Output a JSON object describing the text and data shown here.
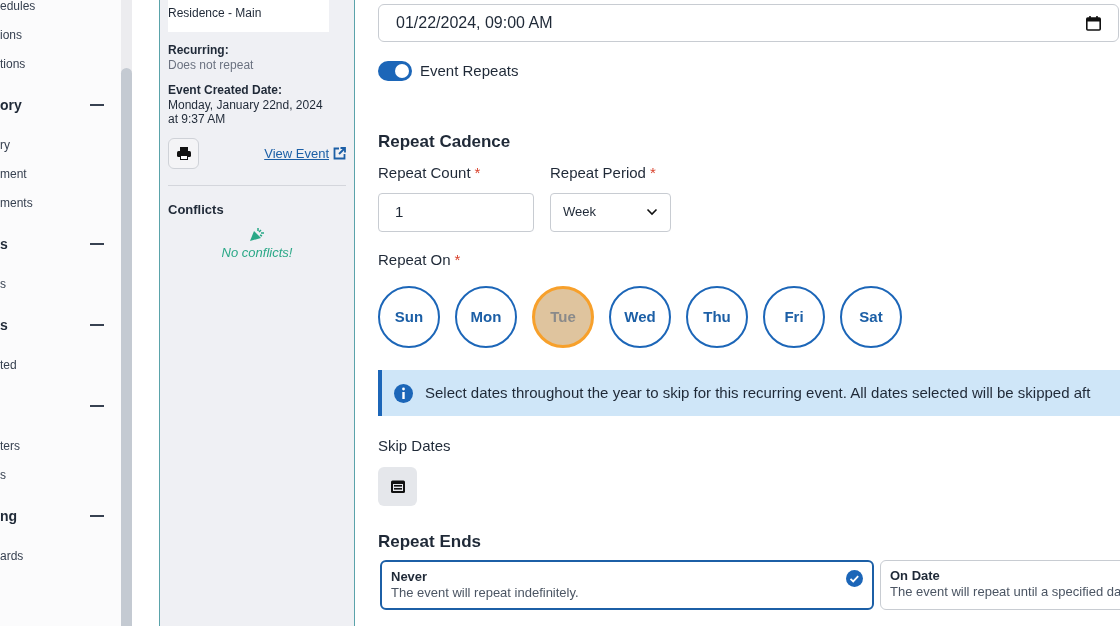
{
  "sidebar": {
    "items": [
      {
        "kind": "link",
        "label": "edules"
      },
      {
        "kind": "link",
        "label": "ions"
      },
      {
        "kind": "link",
        "label": "tions"
      },
      {
        "kind": "header",
        "label": "ory",
        "expanded": true
      },
      {
        "kind": "link",
        "label": "ry"
      },
      {
        "kind": "link",
        "label": "ment"
      },
      {
        "kind": "link",
        "label": "ments"
      },
      {
        "kind": "header",
        "label": "s",
        "expanded": true
      },
      {
        "kind": "link",
        "label": "s"
      },
      {
        "kind": "header",
        "label": "s",
        "expanded": true
      },
      {
        "kind": "link",
        "label": "ted"
      },
      {
        "kind": "header",
        "expanded": true
      },
      {
        "kind": "link",
        "label": "ters"
      },
      {
        "kind": "link",
        "label": "s"
      },
      {
        "kind": "header",
        "label": "ng",
        "expanded": true
      },
      {
        "kind": "link",
        "label": "ards"
      }
    ]
  },
  "details": {
    "location_value": "Residence - Main",
    "fields": [
      {
        "label": "Recurring:",
        "value": "Does not repeat",
        "muted": true
      },
      {
        "label": "Event Created Date:",
        "value": "Monday, January 22nd, 2024 at 9:37 AM",
        "muted": false
      }
    ],
    "view_link": "View Event",
    "conflicts": {
      "title": "Conflicts",
      "message": "No conflicts!"
    }
  },
  "form": {
    "datetime": "01/22/2024, 09:00 AM",
    "repeats": {
      "label": "Event Repeats",
      "on": true
    },
    "cadence": {
      "title": "Repeat Cadence",
      "count_label": "Repeat Count",
      "count_value": "1",
      "period_label": "Repeat Period",
      "period_value": "Week",
      "required_mark": "*"
    },
    "repeat_on": {
      "label": "Repeat On",
      "days": [
        {
          "label": "Sun",
          "selected": false
        },
        {
          "label": "Mon",
          "selected": false
        },
        {
          "label": "Tue",
          "selected": true
        },
        {
          "label": "Wed",
          "selected": false
        },
        {
          "label": "Thu",
          "selected": false
        },
        {
          "label": "Fri",
          "selected": false
        },
        {
          "label": "Sat",
          "selected": false
        }
      ]
    },
    "info": "Select dates throughout the year to skip for this recurring event. All dates selected will be skipped aft",
    "skip_dates": {
      "label": "Skip Dates"
    },
    "repeat_ends": {
      "title": "Repeat Ends",
      "options": [
        {
          "title": "Never",
          "description": "The event will repeat indefinitely.",
          "selected": true
        },
        {
          "title": "On Date",
          "description": "The event will repeat until a specified da",
          "selected": false
        }
      ]
    }
  }
}
